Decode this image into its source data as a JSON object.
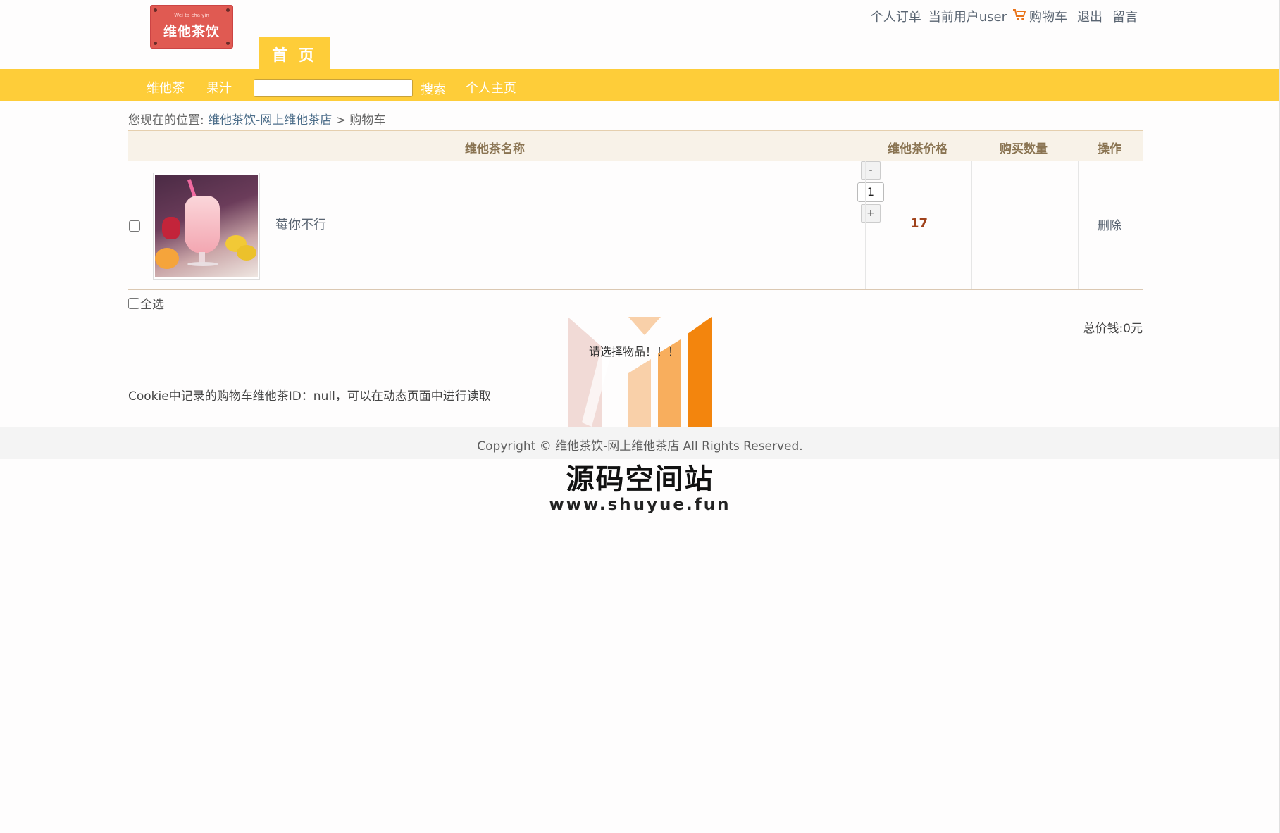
{
  "brand": {
    "logo_small_text": "Wei ta cha yin",
    "logo_text": "维他茶饮"
  },
  "header": {
    "home_tab": "首 页",
    "links": {
      "orders": "个人订单",
      "current_user": "当前用户user",
      "cart_icon": "cart-icon",
      "cart": "购物车",
      "logout": "退出",
      "message": "留言"
    }
  },
  "nav": {
    "tea": "维他茶",
    "juice": "果汁",
    "search_value": "",
    "search_button": "搜索",
    "profile": "个人主页"
  },
  "breadcrumb": {
    "prefix": "您现在的位置:",
    "site": "维他茶饮-网上维他茶店",
    "separator": ">",
    "current": "购物车"
  },
  "cart": {
    "columns": {
      "name": "维他茶名称",
      "price": "维他茶价格",
      "quantity": "购买数量",
      "action": "操作"
    },
    "items": [
      {
        "name": "莓你不行",
        "price": "17",
        "quantity": "1",
        "minus": "-",
        "plus": "+",
        "delete": "删除",
        "checked": false
      }
    ],
    "select_all": "全选",
    "total_label": "总价钱:0元",
    "alert": "请选择物品！！！",
    "cookie_note": "Cookie中记录的购物车维他茶ID：null，可以在动态页面中进行读取"
  },
  "footer": {
    "copyright": "Copyright © 维他茶饮-网上维他茶店 All Rights Reserved."
  },
  "watermark": {
    "title": "源码空间站",
    "url": "www.shuyue.fun",
    "colors": [
      "#efd3cf",
      "#f8c89a",
      "#f7a54b",
      "#f3850d"
    ]
  },
  "colors": {
    "accent_yellow": "#fecd39",
    "price_red": "#a0421b",
    "header_brown": "#8a7452"
  }
}
